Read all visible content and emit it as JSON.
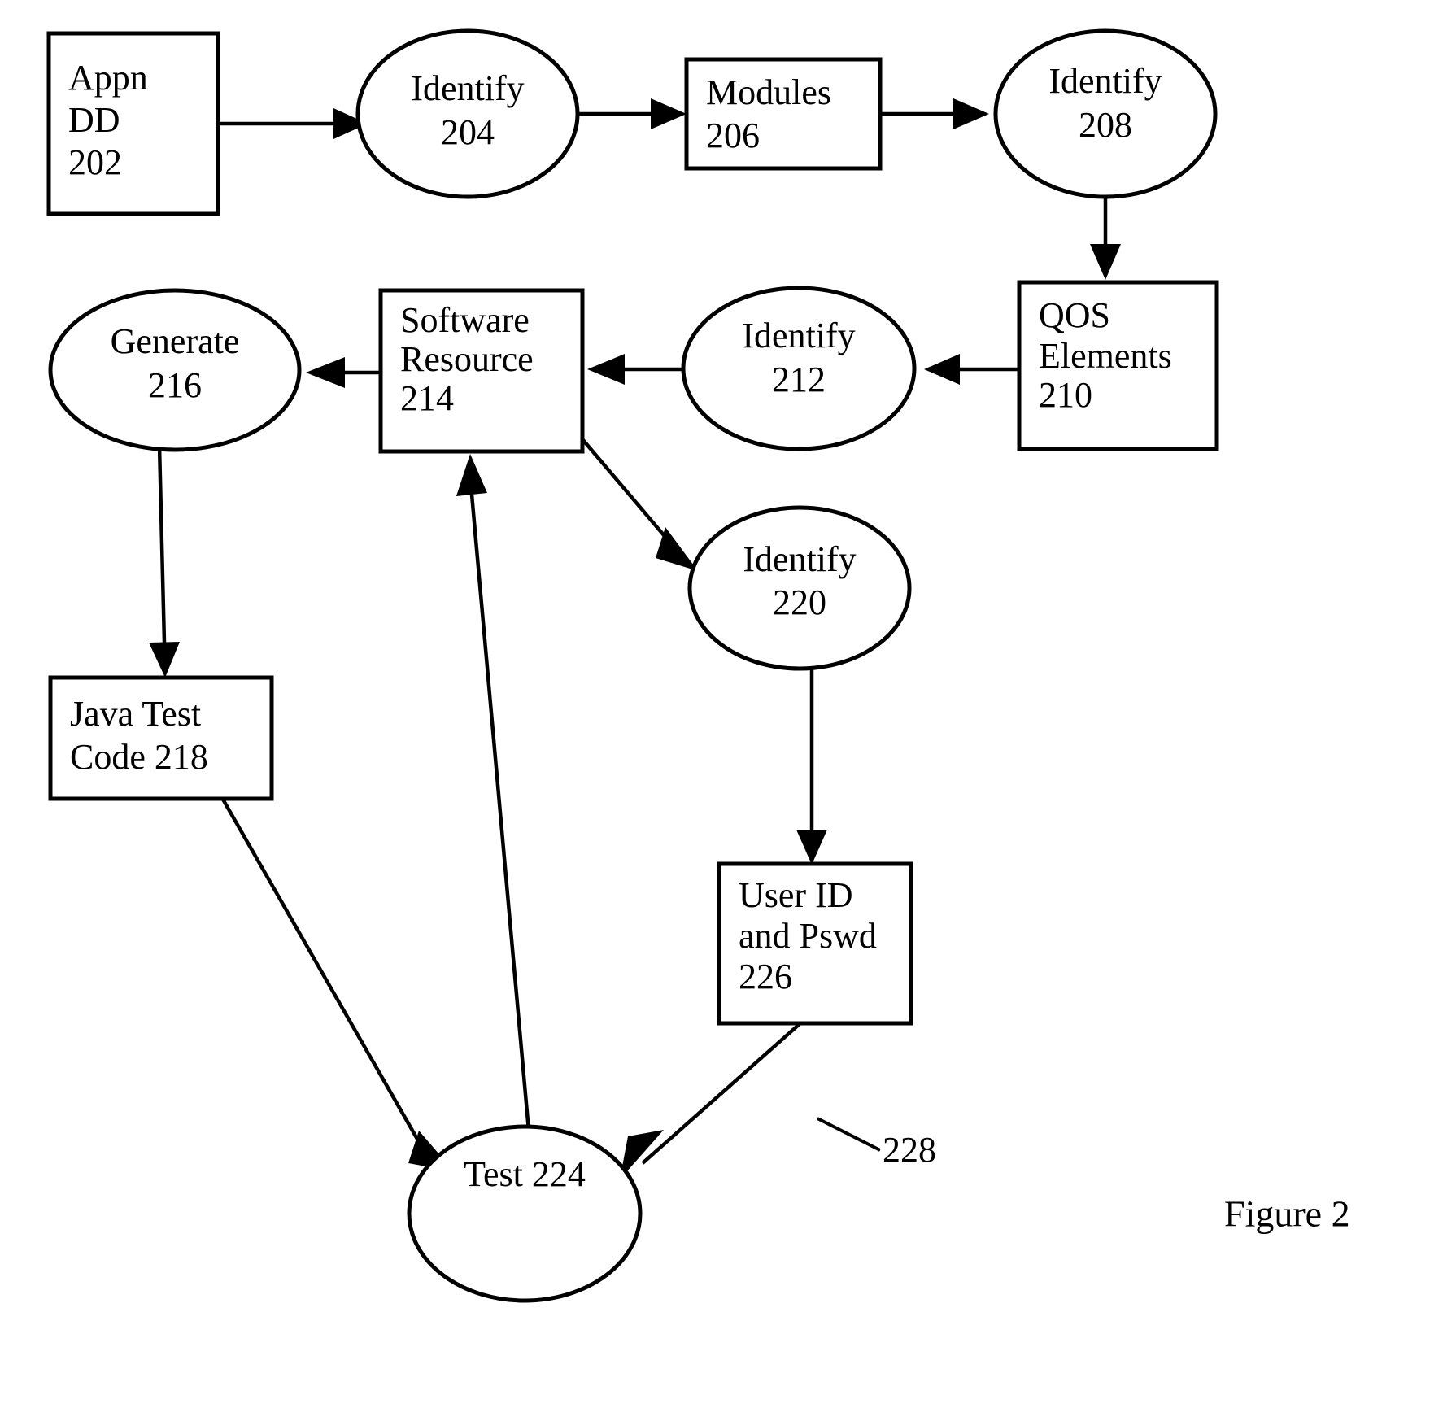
{
  "figure": {
    "caption": "Figure 2",
    "type": "patent-flowchart"
  },
  "chart_data": {
    "type": "diagram",
    "title": "Figure 2",
    "nodes": [
      {
        "id": "202",
        "shape": "rectangle",
        "lines": [
          "Appn",
          "DD",
          "202"
        ],
        "label": "Appn DD 202"
      },
      {
        "id": "204",
        "shape": "ellipse",
        "lines": [
          "Identify",
          "204"
        ],
        "label": "Identify 204"
      },
      {
        "id": "206",
        "shape": "rectangle",
        "lines": [
          "Modules",
          "206"
        ],
        "label": "Modules 206"
      },
      {
        "id": "208",
        "shape": "ellipse",
        "lines": [
          "Identify",
          "208"
        ],
        "label": "Identify 208"
      },
      {
        "id": "210",
        "shape": "rectangle",
        "lines": [
          "QOS",
          "Elements",
          "210"
        ],
        "label": "QOS Elements 210"
      },
      {
        "id": "212",
        "shape": "ellipse",
        "lines": [
          "Identify",
          "212"
        ],
        "label": "Identify 212"
      },
      {
        "id": "214",
        "shape": "rectangle",
        "lines": [
          "Software",
          "Resource",
          "214"
        ],
        "label": "Software Resource 214"
      },
      {
        "id": "216",
        "shape": "ellipse",
        "lines": [
          "Generate",
          "216"
        ],
        "label": "Generate 216"
      },
      {
        "id": "218",
        "shape": "rectangle",
        "lines": [
          "Java Test",
          "Code 218"
        ],
        "label": "Java Test Code 218"
      },
      {
        "id": "220",
        "shape": "ellipse",
        "lines": [
          "Identify",
          "220"
        ],
        "label": "Identify 220"
      },
      {
        "id": "226",
        "shape": "rectangle",
        "lines": [
          "User ID",
          "and Pswd",
          "226"
        ],
        "label": "User ID and Pswd 226"
      },
      {
        "id": "224",
        "shape": "ellipse",
        "lines": [
          "Test 224"
        ],
        "label": "Test 224"
      }
    ],
    "edges": [
      {
        "from": "202",
        "to": "204",
        "arrow": true
      },
      {
        "from": "204",
        "to": "206",
        "arrow": true
      },
      {
        "from": "206",
        "to": "208",
        "arrow": true
      },
      {
        "from": "208",
        "to": "210",
        "arrow": true
      },
      {
        "from": "210",
        "to": "212",
        "arrow": true
      },
      {
        "from": "212",
        "to": "214",
        "arrow": true
      },
      {
        "from": "214",
        "to": "216",
        "arrow": true
      },
      {
        "from": "216",
        "to": "218",
        "arrow": true
      },
      {
        "from": "214",
        "to": "220",
        "arrow": true
      },
      {
        "from": "220",
        "to": "226",
        "arrow": true
      },
      {
        "from": "218",
        "to": "224",
        "arrow": true
      },
      {
        "from": "226",
        "to": "224",
        "arrow": true
      },
      {
        "from": "224",
        "to": "214",
        "arrow": true
      }
    ],
    "annotations": [
      {
        "id": "228",
        "text": "228",
        "kind": "reference-numeral-with-leader"
      }
    ]
  },
  "nodes": {
    "n202": {
      "line1": "Appn",
      "line2": "DD",
      "line3": "202"
    },
    "n204": {
      "line1": "Identify",
      "line2": "204"
    },
    "n206": {
      "line1": "Modules",
      "line2": "206"
    },
    "n208": {
      "line1": "Identify",
      "line2": "208"
    },
    "n210": {
      "line1": "QOS",
      "line2": "Elements",
      "line3": "210"
    },
    "n212": {
      "line1": "Identify",
      "line2": "212"
    },
    "n214": {
      "line1": "Software",
      "line2": "Resource",
      "line3": "214"
    },
    "n216": {
      "line1": "Generate",
      "line2": "216"
    },
    "n218": {
      "line1": "Java Test",
      "line2": "Code 218"
    },
    "n220": {
      "line1": "Identify",
      "line2": "220"
    },
    "n226": {
      "line1": "User ID",
      "line2": "and Pswd",
      "line3": "226"
    },
    "n224": {
      "line1": "Test 224"
    }
  },
  "annotations": {
    "ref228": "228"
  },
  "caption": {
    "text": "Figure 2"
  }
}
